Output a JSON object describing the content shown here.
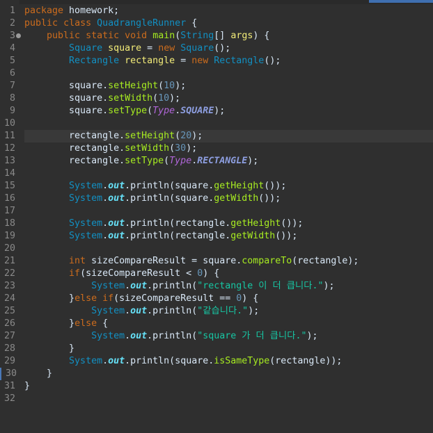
{
  "editor": {
    "language": "java",
    "colors": {
      "background": "#2f2f2f",
      "keyword": "#cc6c1d",
      "type": "#1290c3",
      "method": "#a7ec21",
      "string": "#17c6a3",
      "number": "#6897bb"
    },
    "lines": [
      {
        "n": "1",
        "tokens": [
          [
            "kw",
            "package"
          ],
          [
            "plain",
            " homework;"
          ]
        ]
      },
      {
        "n": "2",
        "tokens": [
          [
            "kw",
            "public"
          ],
          [
            "plain",
            " "
          ],
          [
            "kw",
            "class"
          ],
          [
            "plain",
            " "
          ],
          [
            "type",
            "QuadrangleRunner"
          ],
          [
            "plain",
            " {"
          ]
        ]
      },
      {
        "n": "3",
        "fold": true,
        "tokens": [
          [
            "plain",
            "    "
          ],
          [
            "kw",
            "public"
          ],
          [
            "plain",
            " "
          ],
          [
            "kw",
            "static"
          ],
          [
            "plain",
            " "
          ],
          [
            "kw",
            "void"
          ],
          [
            "plain",
            " "
          ],
          [
            "method",
            "main"
          ],
          [
            "plain",
            "("
          ],
          [
            "type",
            "String"
          ],
          [
            "plain",
            "[] "
          ],
          [
            "var",
            "args"
          ],
          [
            "plain",
            ") {"
          ]
        ]
      },
      {
        "n": "4",
        "tokens": [
          [
            "plain",
            "        "
          ],
          [
            "type",
            "Square"
          ],
          [
            "plain",
            " "
          ],
          [
            "var",
            "square"
          ],
          [
            "plain",
            " = "
          ],
          [
            "kw",
            "new"
          ],
          [
            "plain",
            " "
          ],
          [
            "type",
            "Square"
          ],
          [
            "plain",
            "();"
          ]
        ]
      },
      {
        "n": "5",
        "tokens": [
          [
            "plain",
            "        "
          ],
          [
            "type",
            "Rectangle"
          ],
          [
            "plain",
            " "
          ],
          [
            "var",
            "rectangle"
          ],
          [
            "plain",
            " = "
          ],
          [
            "kw",
            "new"
          ],
          [
            "plain",
            " "
          ],
          [
            "type",
            "Rectangle"
          ],
          [
            "plain",
            "();"
          ]
        ]
      },
      {
        "n": "6",
        "tokens": []
      },
      {
        "n": "7",
        "tokens": [
          [
            "plain",
            "        square."
          ],
          [
            "call",
            "setHeight"
          ],
          [
            "plain",
            "("
          ],
          [
            "num",
            "10"
          ],
          [
            "plain",
            ");"
          ]
        ]
      },
      {
        "n": "8",
        "tokens": [
          [
            "plain",
            "        square."
          ],
          [
            "call",
            "setWidth"
          ],
          [
            "plain",
            "("
          ],
          [
            "num",
            "10"
          ],
          [
            "plain",
            ");"
          ]
        ]
      },
      {
        "n": "9",
        "tokens": [
          [
            "plain",
            "        square."
          ],
          [
            "call",
            "setType"
          ],
          [
            "plain",
            "("
          ],
          [
            "enumtype",
            "Type"
          ],
          [
            "plain",
            "."
          ],
          [
            "enum",
            "SQUARE"
          ],
          [
            "plain",
            ");"
          ]
        ]
      },
      {
        "n": "10",
        "tokens": []
      },
      {
        "n": "11",
        "current": true,
        "tokens": [
          [
            "plain",
            "        rectangle."
          ],
          [
            "call",
            "setHeight"
          ],
          [
            "plain",
            "("
          ],
          [
            "num",
            "20"
          ],
          [
            "plain",
            ");"
          ]
        ]
      },
      {
        "n": "12",
        "tokens": [
          [
            "plain",
            "        rectangle."
          ],
          [
            "call",
            "setWidth"
          ],
          [
            "plain",
            "("
          ],
          [
            "num",
            "30"
          ],
          [
            "plain",
            ");"
          ]
        ]
      },
      {
        "n": "13",
        "tokens": [
          [
            "plain",
            "        rectangle."
          ],
          [
            "call",
            "setType"
          ],
          [
            "plain",
            "("
          ],
          [
            "enumtype",
            "Type"
          ],
          [
            "plain",
            "."
          ],
          [
            "enum",
            "RECTANGLE"
          ],
          [
            "plain",
            ");"
          ]
        ]
      },
      {
        "n": "14",
        "tokens": []
      },
      {
        "n": "15",
        "tokens": [
          [
            "plain",
            "        "
          ],
          [
            "type",
            "System"
          ],
          [
            "plain",
            "."
          ],
          [
            "field",
            "out"
          ],
          [
            "plain",
            ".println(square."
          ],
          [
            "call",
            "getHeight"
          ],
          [
            "plain",
            "());"
          ]
        ]
      },
      {
        "n": "16",
        "tokens": [
          [
            "plain",
            "        "
          ],
          [
            "type",
            "System"
          ],
          [
            "plain",
            "."
          ],
          [
            "field",
            "out"
          ],
          [
            "plain",
            ".println(square."
          ],
          [
            "call",
            "getWidth"
          ],
          [
            "plain",
            "());"
          ]
        ]
      },
      {
        "n": "17",
        "tokens": []
      },
      {
        "n": "18",
        "tokens": [
          [
            "plain",
            "        "
          ],
          [
            "type",
            "System"
          ],
          [
            "plain",
            "."
          ],
          [
            "field",
            "out"
          ],
          [
            "plain",
            ".println(rectangle."
          ],
          [
            "call",
            "getHeight"
          ],
          [
            "plain",
            "());"
          ]
        ]
      },
      {
        "n": "19",
        "tokens": [
          [
            "plain",
            "        "
          ],
          [
            "type",
            "System"
          ],
          [
            "plain",
            "."
          ],
          [
            "field",
            "out"
          ],
          [
            "plain",
            ".println(rectangle."
          ],
          [
            "call",
            "getWidth"
          ],
          [
            "plain",
            "());"
          ]
        ]
      },
      {
        "n": "20",
        "tokens": []
      },
      {
        "n": "21",
        "tokens": [
          [
            "plain",
            "        "
          ],
          [
            "kw",
            "int"
          ],
          [
            "plain",
            " sizeCompareResult = square."
          ],
          [
            "call",
            "compareTo"
          ],
          [
            "plain",
            "(rectangle);"
          ]
        ]
      },
      {
        "n": "22",
        "tokens": [
          [
            "plain",
            "        "
          ],
          [
            "kw",
            "if"
          ],
          [
            "plain",
            "(sizeCompareResult < "
          ],
          [
            "num",
            "0"
          ],
          [
            "plain",
            ") {"
          ]
        ]
      },
      {
        "n": "23",
        "tokens": [
          [
            "plain",
            "            "
          ],
          [
            "type",
            "System"
          ],
          [
            "plain",
            "."
          ],
          [
            "field",
            "out"
          ],
          [
            "plain",
            ".println("
          ],
          [
            "str",
            "\"rectangle 이 더 큽니다.\""
          ],
          [
            "plain",
            ");"
          ]
        ]
      },
      {
        "n": "24",
        "tokens": [
          [
            "plain",
            "        }"
          ],
          [
            "kw",
            "else"
          ],
          [
            "plain",
            " "
          ],
          [
            "kw",
            "if"
          ],
          [
            "plain",
            "(sizeCompareResult == "
          ],
          [
            "num",
            "0"
          ],
          [
            "plain",
            ") {"
          ]
        ]
      },
      {
        "n": "25",
        "tokens": [
          [
            "plain",
            "            "
          ],
          [
            "type",
            "System"
          ],
          [
            "plain",
            "."
          ],
          [
            "field",
            "out"
          ],
          [
            "plain",
            ".println("
          ],
          [
            "str",
            "\"같습니다.\""
          ],
          [
            "plain",
            ");"
          ]
        ]
      },
      {
        "n": "26",
        "tokens": [
          [
            "plain",
            "        }"
          ],
          [
            "kw",
            "else"
          ],
          [
            "plain",
            " {"
          ]
        ]
      },
      {
        "n": "27",
        "tokens": [
          [
            "plain",
            "            "
          ],
          [
            "type",
            "System"
          ],
          [
            "plain",
            "."
          ],
          [
            "field",
            "out"
          ],
          [
            "plain",
            ".println("
          ],
          [
            "str",
            "\"square 가 더 큽니다.\""
          ],
          [
            "plain",
            ");"
          ]
        ]
      },
      {
        "n": "28",
        "tokens": [
          [
            "plain",
            "        }"
          ]
        ]
      },
      {
        "n": "29",
        "tokens": [
          [
            "plain",
            "        "
          ],
          [
            "type",
            "System"
          ],
          [
            "plain",
            "."
          ],
          [
            "field",
            "out"
          ],
          [
            "plain",
            ".println(square."
          ],
          [
            "call",
            "isSameType"
          ],
          [
            "plain",
            "(rectangle));"
          ]
        ]
      },
      {
        "n": "30",
        "changed": true,
        "tokens": [
          [
            "plain",
            "    }"
          ]
        ]
      },
      {
        "n": "31",
        "tokens": [
          [
            "plain",
            "}"
          ]
        ]
      },
      {
        "n": "32",
        "tokens": []
      }
    ]
  }
}
